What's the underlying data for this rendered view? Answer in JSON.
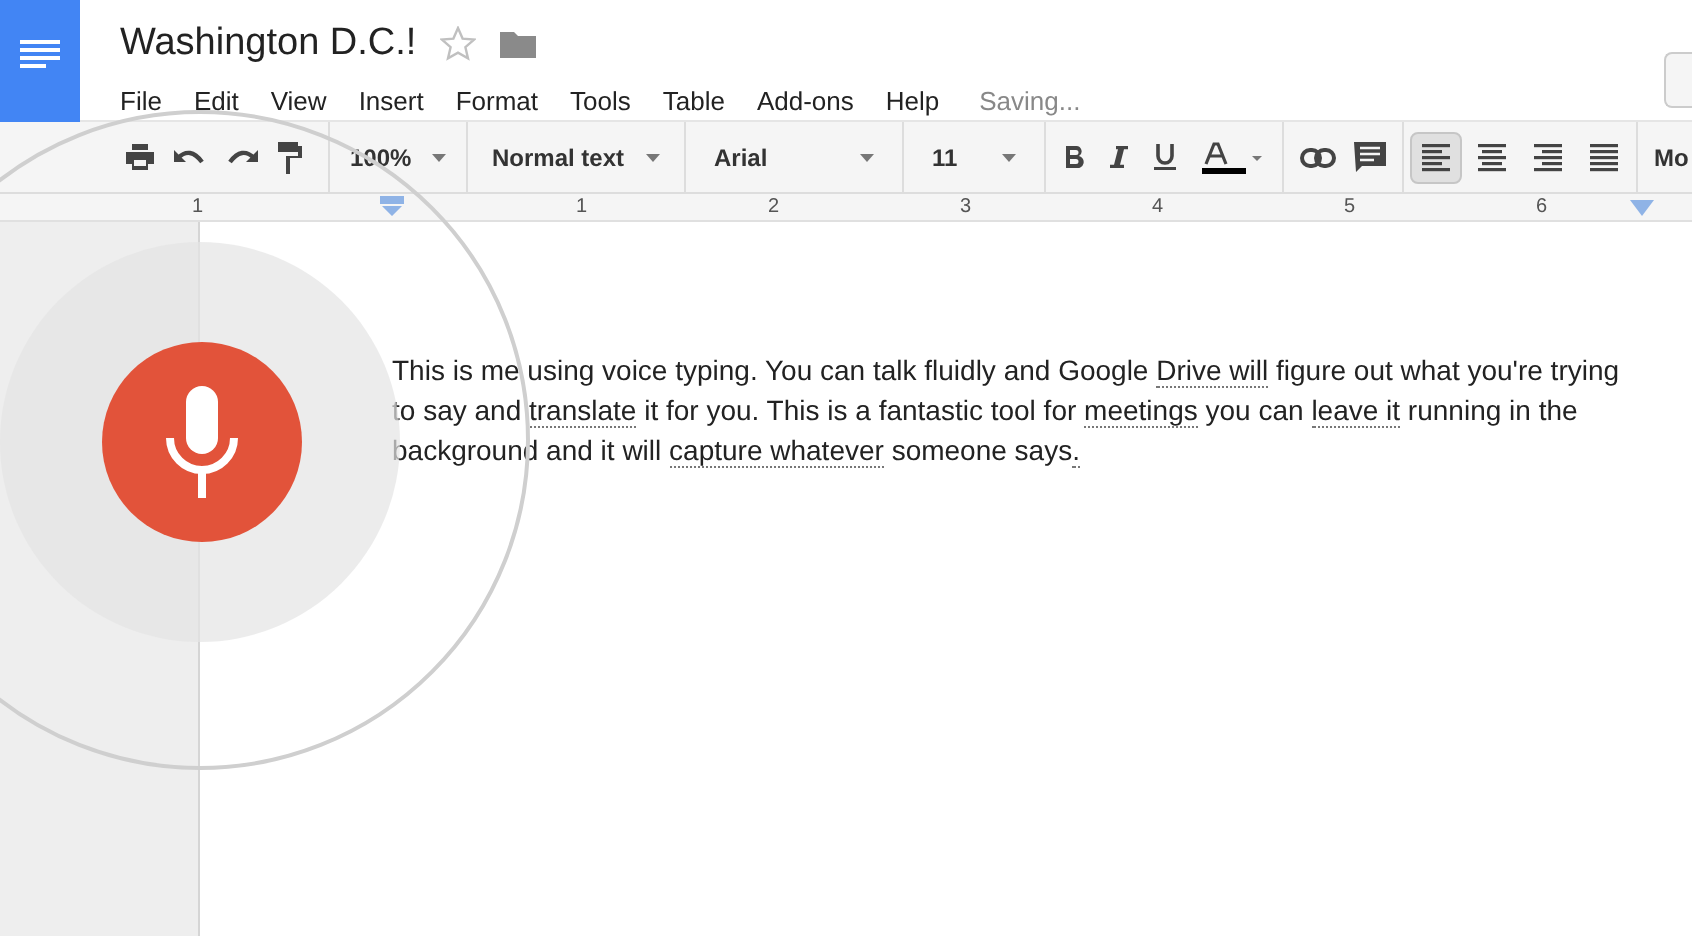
{
  "document": {
    "title": "Washington D.C.!",
    "starred": false
  },
  "menu": [
    "File",
    "Edit",
    "View",
    "Insert",
    "Format",
    "Tools",
    "Table",
    "Add-ons",
    "Help"
  ],
  "save_status": "Saving...",
  "toolbar": {
    "zoom": "100%",
    "style": "Normal text",
    "font": "Arial",
    "size": "11",
    "alignments": [
      {
        "kind": "left",
        "selected": true
      },
      {
        "kind": "center",
        "selected": false
      },
      {
        "kind": "right",
        "selected": false
      },
      {
        "kind": "justify",
        "selected": false
      }
    ],
    "more": "Mo"
  },
  "ruler": [
    "1",
    "1",
    "2",
    "3",
    "4",
    "5",
    "6"
  ],
  "paragraph": [
    {
      "text": "This is me using voice typing. You can talk fluidly and Google ",
      "suggested": false
    },
    {
      "text": "Drive will",
      "suggested": true
    },
    {
      "text": " figure out what you're trying to say and ",
      "suggested": false
    },
    {
      "text": "translate",
      "suggested": true
    },
    {
      "text": " it for you. This is a fantastic tool for ",
      "suggested": false
    },
    {
      "text": "meetings",
      "suggested": true
    },
    {
      "text": " you can ",
      "suggested": false
    },
    {
      "text": "leave it",
      "suggested": true
    },
    {
      "text": " running in the background and it will ",
      "suggested": false
    },
    {
      "text": "capture whatever",
      "suggested": true
    },
    {
      "text": " someone says",
      "suggested": false
    },
    {
      "text": ".",
      "suggested": true
    }
  ],
  "voice_typing": {
    "listening": true
  }
}
